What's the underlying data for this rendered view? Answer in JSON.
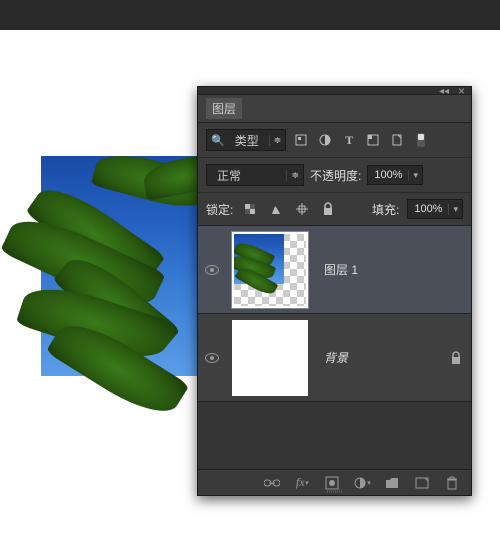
{
  "panel": {
    "title": "图层",
    "filter": {
      "kind_label": "类型"
    },
    "blend": {
      "mode": "正常",
      "opacity_label": "不透明度:",
      "opacity_value": "100%"
    },
    "lock": {
      "label": "锁定:",
      "fill_label": "填充:",
      "fill_value": "100%"
    },
    "layers": [
      {
        "name": "图层 1",
        "visible": true,
        "locked": false,
        "selected": true
      },
      {
        "name": "背景",
        "visible": true,
        "locked": true,
        "selected": false
      }
    ]
  }
}
